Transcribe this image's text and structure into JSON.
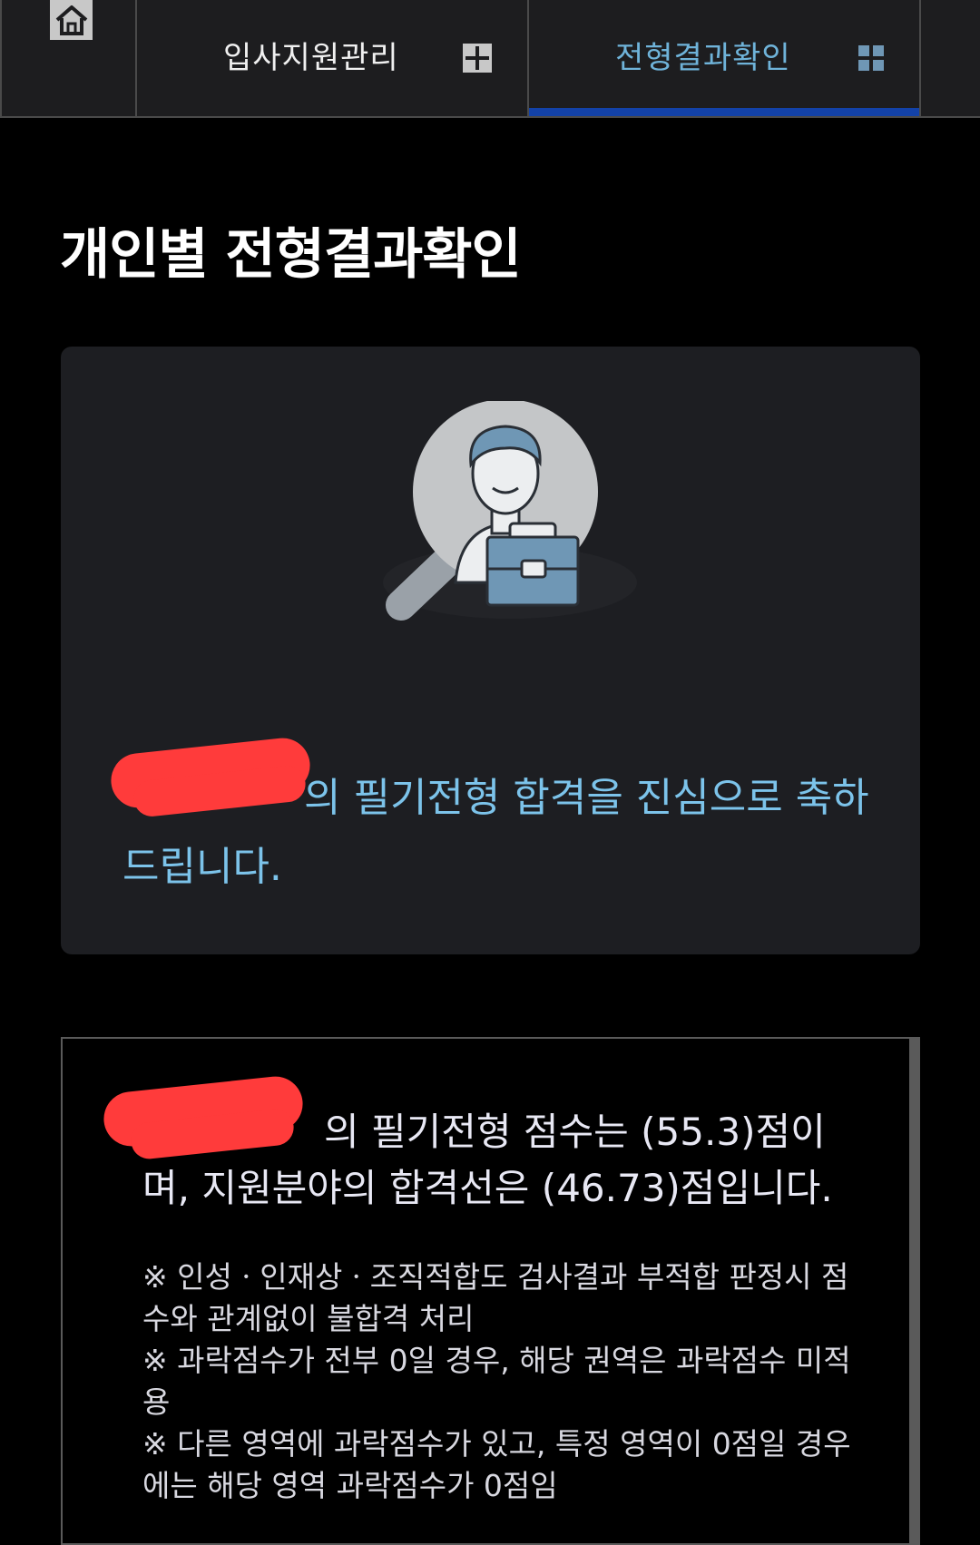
{
  "nav": {
    "tab_apply": "입사지원관리",
    "tab_result": "전형결과확인"
  },
  "page": {
    "title": "개인별 전형결과확인"
  },
  "result_card": {
    "congrats_suffix": "의 필기전형 합격을 진심으로 축하드립니다."
  },
  "score_card": {
    "score_text": "의 필기전형 점수는 (55.3)점이며, 지원분야의 합격선은 (46.73)점입니다.",
    "notes": [
      "※ 인성ㆍ인재상ㆍ조직적합도 검사결과 부적합 판정시 점수와 관계없이 불합격 처리",
      "※ 과락점수가 전부 0일 경우, 해당 권역은 과락점수 미적용",
      "※ 다른 영역에 과락점수가 있고, 특정 영역이 0점일 경우에는 해당 영역 과락점수가 0점임"
    ]
  },
  "colors": {
    "accent_blue": "#7cc3ea",
    "active_bar": "#1342a8",
    "redaction": "#ff3b3b"
  },
  "icons": [
    "home-icon",
    "plus-icon",
    "grid-icon",
    "search-person-icon"
  ]
}
